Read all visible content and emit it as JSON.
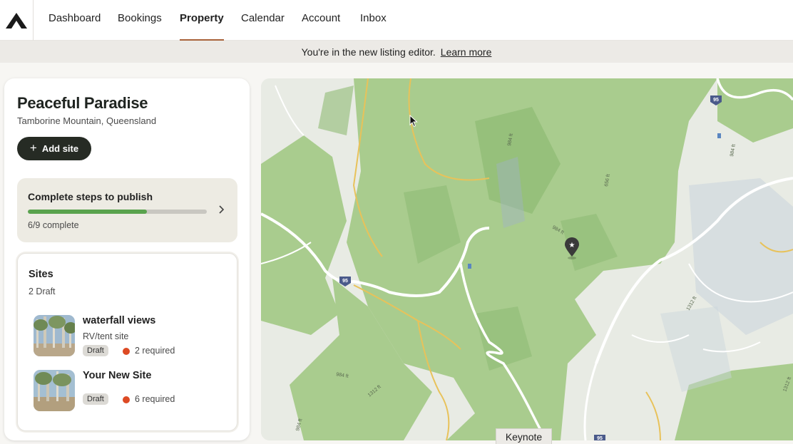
{
  "nav": {
    "logo": "mountain-logo",
    "items": [
      {
        "label": "Dashboard"
      },
      {
        "label": "Bookings"
      },
      {
        "label": "Property",
        "active": true
      },
      {
        "label": "Calendar"
      },
      {
        "label": "Account"
      },
      {
        "label": "Inbox"
      }
    ]
  },
  "banner": {
    "text": "You're in the new listing editor.",
    "link": "Learn more"
  },
  "property": {
    "title": "Peaceful Paradise",
    "location": "Tamborine Mountain, Queensland",
    "add_site_label": "Add site"
  },
  "steps": {
    "title": "Complete steps to publish",
    "count_text": "6/9 complete",
    "progress": 0.667
  },
  "sites": {
    "title": "Sites",
    "subtitle": "2 Draft",
    "items": [
      {
        "name": "waterfall views",
        "type": "RV/tent site",
        "status": "Draft",
        "required": "2 required"
      },
      {
        "name": "Your New Site",
        "type": "",
        "status": "Draft",
        "required": "6 required"
      }
    ]
  },
  "map": {
    "labels": {
      "highway_1": "95",
      "highway_2": "95",
      "highway_3": "95",
      "contour_1": "984 ft",
      "contour_2": "984 ft",
      "contour_3": "984 ft",
      "contour_4": "656 ft",
      "contour_5": "984 ft",
      "contour_6": "1312 ft",
      "contour_7": "984 ft",
      "contour_8": "1312 ft",
      "contour_9": "1312 ft"
    },
    "colors": {
      "forest": "#a9cc8e",
      "forest_dark": "#8fbb74",
      "land": "#e8ebe4",
      "road": "#ffffff",
      "track": "#e8c25a",
      "water": "#5a86c0",
      "highway_badge": "#4a5a8a"
    }
  },
  "overlay": {
    "keynote": "Keynote"
  },
  "colors": {
    "accent": "#a8623a",
    "progress": "#5aa34e",
    "required_dot": "#dd4a24",
    "button": "#262b24"
  }
}
